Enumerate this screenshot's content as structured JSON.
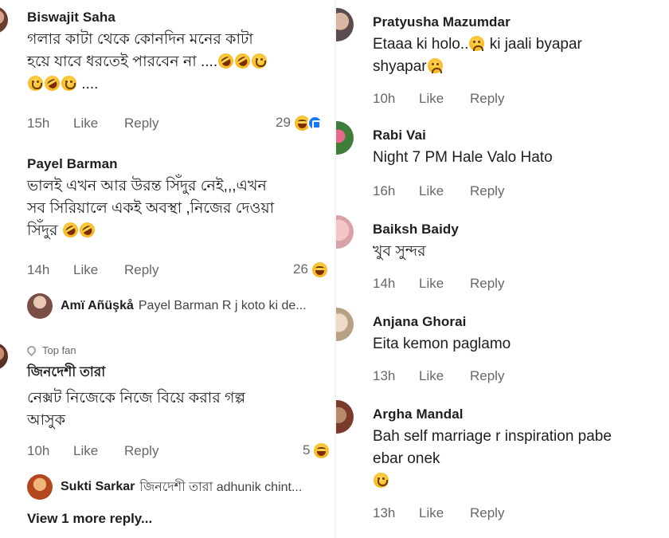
{
  "left": {
    "comments": [
      {
        "name": "Biswajit Saha",
        "line1": "গলার কাটা থেকে কোনদিন মনের কাটা",
        "line2": "হয়ে যাবে ধরতেই পারবেন না ....",
        "line3": "....",
        "time": "15h",
        "like": "Like",
        "reply": "Reply",
        "reactions": "29"
      },
      {
        "name": "Payel Barman",
        "line1": "ভালই এখন আর উরন্ত  সিঁদুর নেই,,,এখন",
        "line2": "সব সিরিয়ালে একই অবস্থা ,নিজের দেওয়া",
        "line3": "সিঁদুর",
        "time": "14h",
        "like": "Like",
        "reply": "Reply",
        "reactions": "26",
        "reply_preview": {
          "name": "Amï Añüşkå",
          "text": "Payel Barman R j koto ki de..."
        }
      },
      {
        "badge": "Top fan",
        "name": "জিনদেশী তারা",
        "line1": "নেক্সট নিজেকে নিজে বিয়ে করার গল্প",
        "line2": "আসুক",
        "time": "10h",
        "like": "Like",
        "reply": "Reply",
        "reactions": "5",
        "reply_preview": {
          "name": "Sukti Sarkar",
          "text": "জিনদেশী তারা adhunik chint..."
        },
        "more_replies": "View 1 more reply..."
      }
    ]
  },
  "right": {
    "comments": [
      {
        "name": "Pratyusha Mazumdar",
        "line1": "Etaaa ki holo..",
        "line1b": "ki jaali byapar",
        "line2": "shyapar",
        "time": "10h",
        "like": "Like",
        "reply": "Reply"
      },
      {
        "name": "Rabi Vai",
        "line1": "Night 7 PM Hale Valo Hato",
        "time": "16h",
        "like": "Like",
        "reply": "Reply"
      },
      {
        "name": "Baiksh Baidy",
        "line1": "খুব সুন্দর",
        "time": "14h",
        "like": "Like",
        "reply": "Reply"
      },
      {
        "name": "Anjana Ghorai",
        "line1": "Eita kemon paglamo",
        "time": "13h",
        "like": "Like",
        "reply": "Reply"
      },
      {
        "name": "Argha Mandal",
        "line1": "Bah self marriage r inspiration pabe",
        "line2": "ebar onek",
        "time": "13h",
        "like": "Like",
        "reply": "Reply"
      }
    ]
  },
  "colors": {
    "meta": "#65676b",
    "text": "#1c1e21",
    "like_blue": "#1877f2",
    "emoji": "#f7b51b"
  }
}
